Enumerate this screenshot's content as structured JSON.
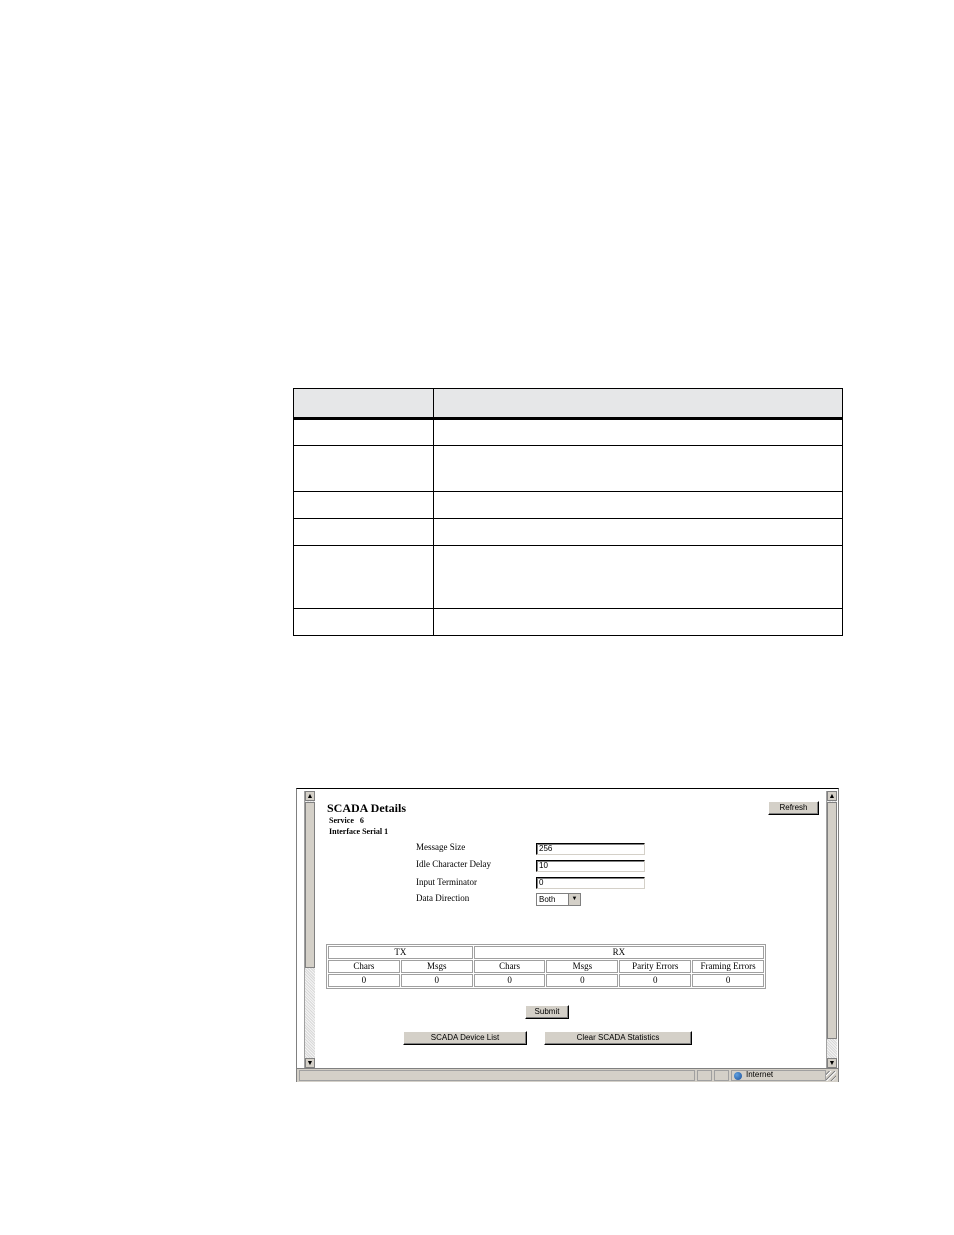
{
  "scada": {
    "title": "SCADA Details",
    "service_line": "Service   6",
    "interface_line": "Interface Serial 1",
    "refresh_label": "Refresh",
    "fields": {
      "message_size": {
        "label": "Message Size",
        "value": "256"
      },
      "idle_char_delay": {
        "label": "Idle Character Delay",
        "value": "10"
      },
      "input_terminator": {
        "label": "Input Terminator",
        "value": "0"
      },
      "data_direction": {
        "label": "Data Direction",
        "value": "Both"
      }
    },
    "stats": {
      "groups": [
        "TX",
        "RX"
      ],
      "columns": [
        "Chars",
        "Msgs",
        "Chars",
        "Msgs",
        "Parity Errors",
        "Framing Errors"
      ],
      "values": [
        "0",
        "0",
        "0",
        "0",
        "0",
        "0"
      ]
    },
    "submit_label": "Submit",
    "device_list_label": "SCADA Device List",
    "clear_stats_label": "Clear SCADA Statistics",
    "status_zone": "Internet"
  }
}
